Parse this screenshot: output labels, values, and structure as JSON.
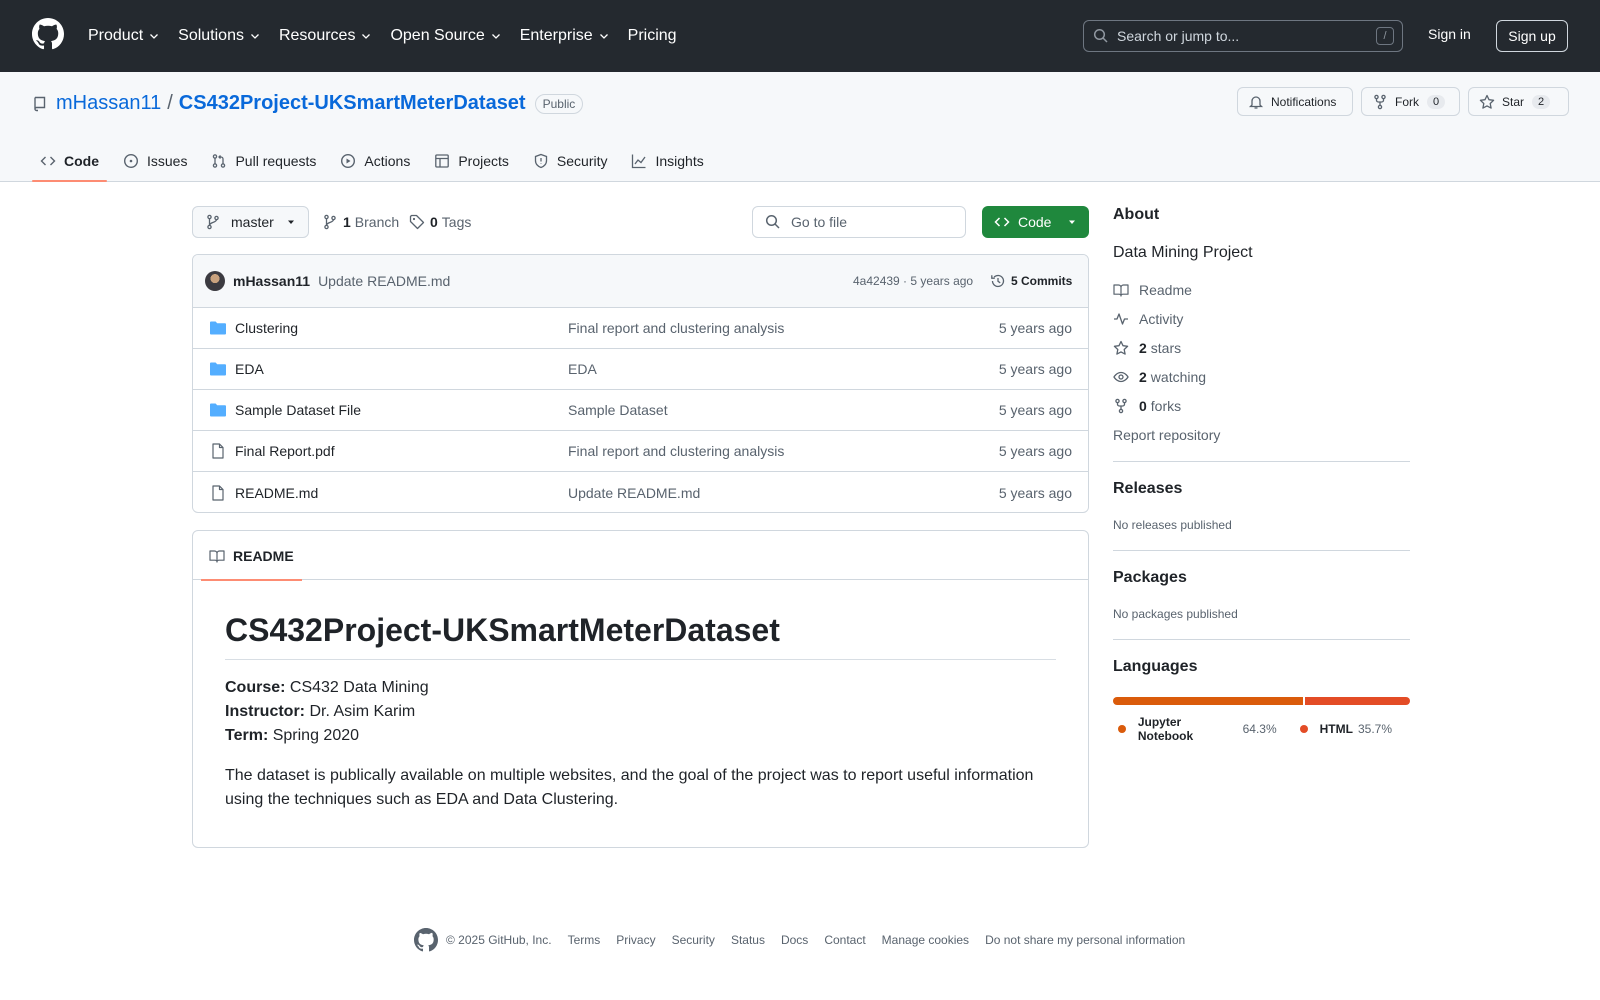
{
  "header": {
    "nav": [
      {
        "label": "Product",
        "dropdown": true
      },
      {
        "label": "Solutions",
        "dropdown": true
      },
      {
        "label": "Resources",
        "dropdown": true
      },
      {
        "label": "Open Source",
        "dropdown": true
      },
      {
        "label": "Enterprise",
        "dropdown": true
      },
      {
        "label": "Pricing",
        "dropdown": false
      }
    ],
    "search_placeholder": "Search or jump to...",
    "search_shortcut": "/",
    "sign_in": "Sign in",
    "sign_up": "Sign up"
  },
  "repo": {
    "owner": "mHassan11",
    "separator": "/",
    "name": "CS432Project-UKSmartMeterDataset",
    "visibility": "Public",
    "notifications_label": "Notifications",
    "fork_label": "Fork",
    "fork_count": "0",
    "star_label": "Star",
    "star_count": "2",
    "tabs": [
      {
        "label": "Code",
        "icon": "code-icon",
        "active": true
      },
      {
        "label": "Issues",
        "icon": "issue-icon",
        "active": false
      },
      {
        "label": "Pull requests",
        "icon": "pull-request-icon",
        "active": false
      },
      {
        "label": "Actions",
        "icon": "play-icon",
        "active": false
      },
      {
        "label": "Projects",
        "icon": "table-icon",
        "active": false
      },
      {
        "label": "Security",
        "icon": "shield-icon",
        "active": false
      },
      {
        "label": "Insights",
        "icon": "graph-icon",
        "active": false
      }
    ]
  },
  "toolbar": {
    "branch": "master",
    "branch_count": "1",
    "branch_label": "Branch",
    "tag_count": "0",
    "tag_label": "Tags",
    "goto_placeholder": "Go to file",
    "code_button": "Code"
  },
  "latest_commit": {
    "author": "mHassan11",
    "message": "Update README.md",
    "hash_time": "4a42439 · 5 years ago",
    "commits": "5 Commits"
  },
  "files": [
    {
      "type": "folder",
      "name": "Clustering",
      "message": "Final report and clustering analysis",
      "date": "5 years ago"
    },
    {
      "type": "folder",
      "name": "EDA",
      "message": "EDA",
      "date": "5 years ago"
    },
    {
      "type": "folder",
      "name": "Sample Dataset File",
      "message": "Sample Dataset",
      "date": "5 years ago"
    },
    {
      "type": "file",
      "name": "Final Report.pdf",
      "message": "Final report and clustering analysis",
      "date": "5 years ago"
    },
    {
      "type": "file",
      "name": "README.md",
      "message": "Update README.md",
      "date": "5 years ago"
    }
  ],
  "readme": {
    "tab": "README",
    "title": "CS432Project-UKSmartMeterDataset",
    "course_label": "Course:",
    "course": "CS432 Data Mining",
    "instructor_label": "Instructor:",
    "instructor": "Dr. Asim Karim",
    "term_label": "Term:",
    "term": "Spring 2020",
    "description": "The dataset is publically available on multiple websites, and the goal of the project was to report useful information using the techniques such as EDA and Data Clustering."
  },
  "about": {
    "heading": "About",
    "description": "Data Mining Project",
    "readme": "Readme",
    "activity": "Activity",
    "stars_count": "2",
    "stars_label": "stars",
    "watching_count": "2",
    "watching_label": "watching",
    "forks_count": "0",
    "forks_label": "forks",
    "report": "Report repository"
  },
  "releases": {
    "heading": "Releases",
    "text": "No releases published"
  },
  "packages": {
    "heading": "Packages",
    "text": "No packages published"
  },
  "languages": {
    "heading": "Languages",
    "items": [
      {
        "name": "Jupyter Notebook",
        "percent": "64.3%",
        "value": 64.3,
        "color": "#DA5B0B"
      },
      {
        "name": "HTML",
        "percent": "35.7%",
        "value": 35.7,
        "color": "#e34c26"
      }
    ]
  },
  "footer": {
    "copyright": "© 2025 GitHub, Inc.",
    "links": [
      "Terms",
      "Privacy",
      "Security",
      "Status",
      "Docs",
      "Contact",
      "Manage cookies",
      "Do not share my personal information"
    ]
  }
}
